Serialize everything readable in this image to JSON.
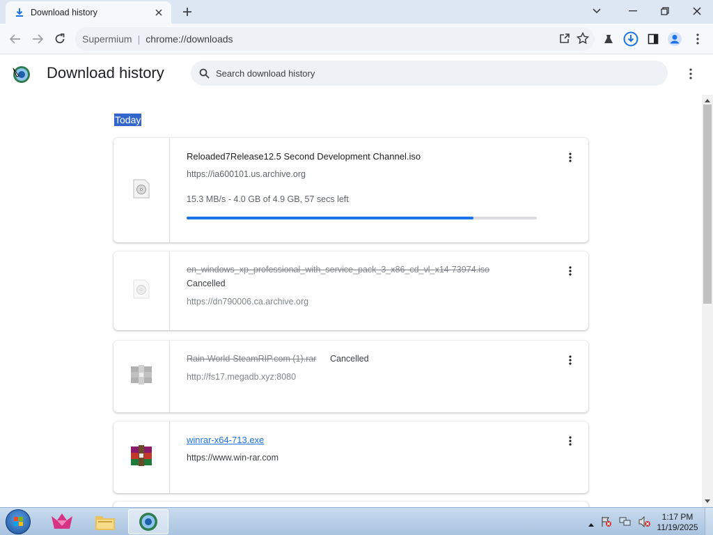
{
  "browser": {
    "tab_title": "Download history",
    "omnibox_site": "Supermium",
    "omnibox_separator": "|",
    "omnibox_url": "chrome://downloads"
  },
  "page": {
    "title": "Download history",
    "search_placeholder": "Search download history",
    "date_header": "Today"
  },
  "downloads": [
    {
      "name": "Reloaded7Release12.5 Second Development Channel.iso",
      "url": "https://ia600101.us.archive.org",
      "status": "15.3 MB/s - 4.0 GB of 4.9 GB, 57 secs left",
      "progress": 0.82
    },
    {
      "name": "en_windows_xp_professional_with_service_pack_3_x86_cd_vl_x14-73974.iso",
      "status": "Cancelled",
      "url": "https://dn790006.ca.archive.org"
    },
    {
      "name": "Rain-World-SteamRIP.com (1).rar",
      "status": "Cancelled",
      "url": "http://fs17.megadb.xyz:8080"
    },
    {
      "name": "winrar-x64-713.exe",
      "url": "https://www.win-rar.com"
    }
  ],
  "taskbar": {
    "time": "1:17 PM",
    "date": "11/19/2025"
  },
  "colors": {
    "accent": "#1a73e8",
    "selection": "#3366cc",
    "titlebar": "#dde6f3"
  }
}
